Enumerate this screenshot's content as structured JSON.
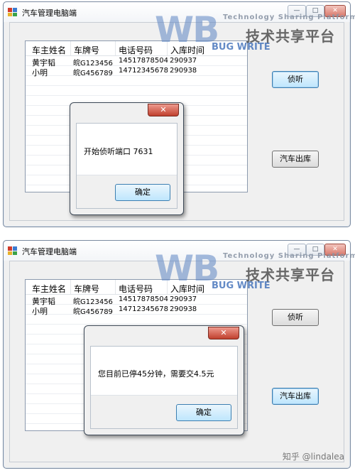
{
  "window_title": "汽车管理电脑端",
  "window_controls": {
    "minimize": "—",
    "maximize": "□",
    "close": "✕"
  },
  "columns": [
    "车主姓名",
    "车牌号",
    "电话号码",
    "入库时间"
  ],
  "rows": [
    [
      "黄宇韬",
      "皖G123456",
      "14517878504",
      "290937"
    ],
    [
      "小明",
      "皖G456789",
      "14712345678",
      "290938"
    ]
  ],
  "buttons": {
    "listen": "侦听",
    "checkout": "汽车出库"
  },
  "dialog1": {
    "message": "开始侦听端口 7631",
    "ok": "确定",
    "close": "✕"
  },
  "dialog2": {
    "message": "您目前已停45分钟，需要交4.5元",
    "ok": "确定",
    "close": "✕"
  },
  "watermark": {
    "logo_w": "WB",
    "logo_b": "BUG WRITE",
    "tagline": "Technology Sharing Platform",
    "cn": "技术共享平台"
  },
  "credit": "知乎 @lindalea"
}
